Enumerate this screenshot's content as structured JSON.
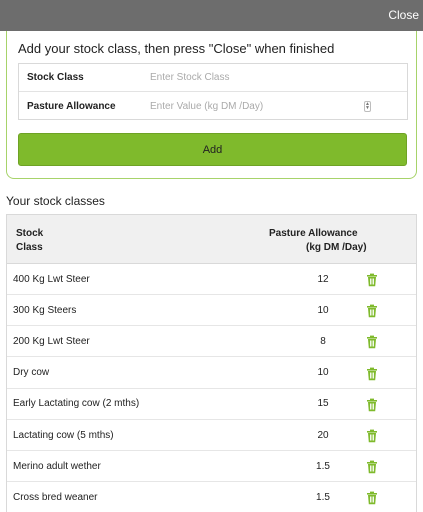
{
  "topbar": {
    "close_label": "Close"
  },
  "form": {
    "heading": "Add your stock class, then press \"Close\" when finished",
    "stock_class_label": "Stock Class",
    "stock_class_placeholder": "Enter Stock Class",
    "allowance_label": "Pasture Allowance",
    "allowance_placeholder": "Enter Value (kg DM /Day)",
    "add_label": "Add"
  },
  "list": {
    "title": "Your stock classes",
    "header_class_line1": "Stock",
    "header_class_line2": "Class",
    "header_allow_line1": "Pasture Allowance",
    "header_allow_line2": "(kg DM /Day)",
    "rows": [
      {
        "name": "400 Kg Lwt Steer",
        "value": "12"
      },
      {
        "name": "300 Kg Steers",
        "value": "10"
      },
      {
        "name": "200 Kg Lwt Steer",
        "value": "8"
      },
      {
        "name": "Dry cow",
        "value": "10"
      },
      {
        "name": "Early Lactating cow (2 mths)",
        "value": "15"
      },
      {
        "name": "Lactating cow (5 mths)",
        "value": "20"
      },
      {
        "name": "Merino adult wether",
        "value": "1.5"
      },
      {
        "name": "Cross bred weaner",
        "value": "1.5"
      }
    ]
  },
  "icons": {
    "delete": "trash-icon"
  },
  "colors": {
    "accent": "#7fba2c",
    "topbar": "#6d6d6d",
    "trash": "#7fba2c"
  }
}
